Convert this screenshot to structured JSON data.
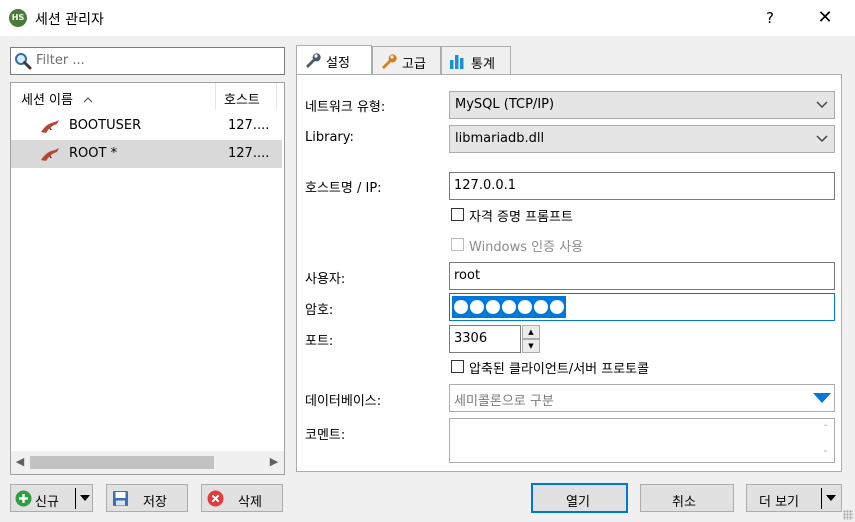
{
  "window": {
    "title": "세션 관리자",
    "app_icon_text": "HS",
    "help_label": "?",
    "close_label": "✕"
  },
  "sessions": {
    "filter_placeholder": "Filter ...",
    "columns": {
      "name": "세션 이름",
      "sort_indicator": "^",
      "host": "호스트"
    },
    "rows": [
      {
        "name": "BOOTUSER",
        "host": "127....",
        "selected": false
      },
      {
        "name": "ROOT *",
        "host": "127....",
        "selected": true
      }
    ]
  },
  "tabs": [
    {
      "label": "설정",
      "icon": "wrench-icon",
      "active": true
    },
    {
      "label": "고급",
      "icon": "wrench-orange-icon",
      "active": false
    },
    {
      "label": "통계",
      "icon": "bar-chart-icon",
      "active": false
    }
  ],
  "settings": {
    "network_type_label": "네트워크 유형:",
    "network_type_value": "MySQL (TCP/IP)",
    "library_label": "Library:",
    "library_value": "libmariadb.dll",
    "host_label": "호스트명 / IP:",
    "host_value": "127.0.0.1",
    "prompt_credentials_label": "자격 증명 프롬프트",
    "prompt_credentials_checked": false,
    "windows_auth_label": "Windows 인증 사용",
    "windows_auth_checked": false,
    "user_label": "사용자:",
    "user_value": "root",
    "password_label": "암호:",
    "password_length": 7,
    "port_label": "포트:",
    "port_value": "3306",
    "compressed_label": "압축된 클라이언트/서버 프로토콜",
    "compressed_checked": false,
    "databases_label": "데이터베이스:",
    "databases_placeholder": "세미콜론으로 구분",
    "comment_label": "코멘트:",
    "comment_value": ""
  },
  "buttons": {
    "new": "신규",
    "save": "저장",
    "delete": "삭제",
    "open": "열기",
    "cancel": "취소",
    "more": "더 보기"
  },
  "colors": {
    "accent": "#0078d7",
    "selection": "#d9d9d9"
  }
}
